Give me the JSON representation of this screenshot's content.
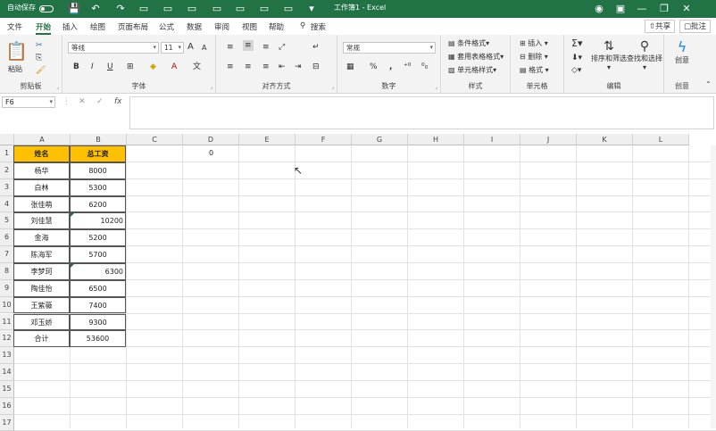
{
  "titlebar": {
    "autosave_label": "自动保存",
    "autosave_state": "关",
    "doc_title": "工作簿1 - Excel",
    "icons": [
      "save-icon",
      "undo-icon",
      "redo-icon",
      "form-icon",
      "form-icon",
      "form-icon",
      "form-icon",
      "form-icon",
      "form-icon",
      "form-icon",
      "form-icon",
      "form-icon",
      "customize-icon"
    ],
    "window_controls": [
      "person-icon",
      "ribbon-display-icon",
      "minimize-icon",
      "restore-icon",
      "close-icon"
    ],
    "accent": "#217346"
  },
  "tabs": {
    "items": [
      "文件",
      "开始",
      "插入",
      "绘图",
      "页面布局",
      "公式",
      "数据",
      "审阅",
      "视图",
      "帮助"
    ],
    "active": "开始",
    "search_label": "搜索",
    "share_label": "共享",
    "comments_label": "批注"
  },
  "ribbon": {
    "clipboard": {
      "label": "剪贴板",
      "paste_label": "粘贴"
    },
    "font": {
      "label": "字体",
      "font_name": "等线",
      "font_size": "11",
      "bold": "B",
      "italic": "I",
      "underline": "U",
      "grow": "A",
      "shrink": "A",
      "font_color": "A"
    },
    "alignment": {
      "label": "对齐方式"
    },
    "number": {
      "label": "数字",
      "format": "常规",
      "percent": "%",
      "comma": ","
    },
    "styles": {
      "label": "样式",
      "conditional": "条件格式",
      "table_format": "套用表格格式",
      "cell_styles": "单元格样式"
    },
    "cells": {
      "label": "单元格",
      "insert": "插入",
      "delete": "删除",
      "format": "格式"
    },
    "editing": {
      "label": "编辑",
      "sort_filter": "排序和筛选",
      "find_select": "查找和选择"
    },
    "create": {
      "label": "创意",
      "create_btn": "创意"
    }
  },
  "formula_bar": {
    "name_box": "F6",
    "cancel": "✕",
    "enter": "✓",
    "fx": "fx",
    "formula": ""
  },
  "sheet": {
    "columns": [
      "A",
      "B",
      "C",
      "D",
      "E",
      "F",
      "G",
      "H",
      "I",
      "J",
      "K",
      "L"
    ],
    "rows": [
      "1",
      "2",
      "3",
      "4",
      "5",
      "6",
      "7",
      "8",
      "9",
      "10",
      "11",
      "12",
      "13",
      "14",
      "15",
      "16",
      "17"
    ],
    "header_fill": "#ffc000",
    "data": [
      {
        "a": "姓名",
        "b": "总工资",
        "header": true
      },
      {
        "a": "杨华",
        "b": "8000"
      },
      {
        "a": "白林",
        "b": "5300"
      },
      {
        "a": "张佳萌",
        "b": "6200"
      },
      {
        "a": "刘佳慧",
        "b": "10200",
        "text_number": true
      },
      {
        "a": "金海",
        "b": "5200"
      },
      {
        "a": "陈海军",
        "b": "5700"
      },
      {
        "a": "李梦珂",
        "b": "6300",
        "text_number": true
      },
      {
        "a": "陶佳怡",
        "b": "6500"
      },
      {
        "a": "王紫薇",
        "b": "7400"
      },
      {
        "a": "邓玉娇",
        "b": "9300"
      },
      {
        "a": "合计",
        "b": "53600"
      }
    ],
    "d1": "0"
  }
}
